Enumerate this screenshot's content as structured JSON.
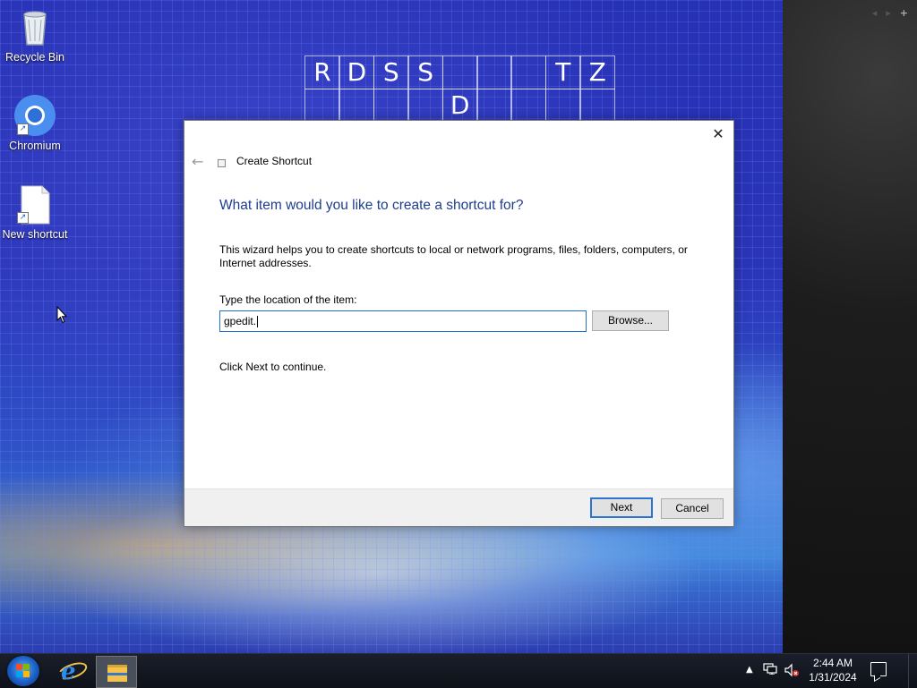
{
  "desktop": {
    "board": {
      "row1": [
        "R",
        "D",
        "S",
        "S",
        "",
        "",
        "",
        "T",
        "Z"
      ],
      "row2": [
        "",
        "",
        "",
        "",
        "D",
        "",
        "",
        "",
        ""
      ]
    },
    "icons": [
      {
        "label": "Recycle Bin",
        "icon": "recycle-bin-icon"
      },
      {
        "label": "Chromium",
        "icon": "chromium-icon"
      },
      {
        "label": "New shortcut",
        "icon": "blank-document-icon"
      }
    ]
  },
  "dialog": {
    "title": "Create Shortcut",
    "heading": "What item would you like to create a shortcut for?",
    "description": "This wizard helps you to create shortcuts to local or network programs, files, folders, computers, or Internet addresses.",
    "location_label": "Type the location of the item:",
    "location_value": "gpedit.",
    "browse_label": "Browse...",
    "continue_text": "Click Next to continue.",
    "next_label": "Next",
    "cancel_label": "Cancel",
    "close_symbol": "✕",
    "back_symbol": "←"
  },
  "taskbar": {
    "pinned": [
      {
        "name": "internet-explorer-icon"
      },
      {
        "name": "file-explorer-icon"
      }
    ],
    "tray": {
      "chevron": "▲",
      "time": "2:44 AM",
      "date": "1/31/2024"
    }
  },
  "strip": {
    "controls": [
      "◂",
      "▸",
      "+"
    ]
  }
}
